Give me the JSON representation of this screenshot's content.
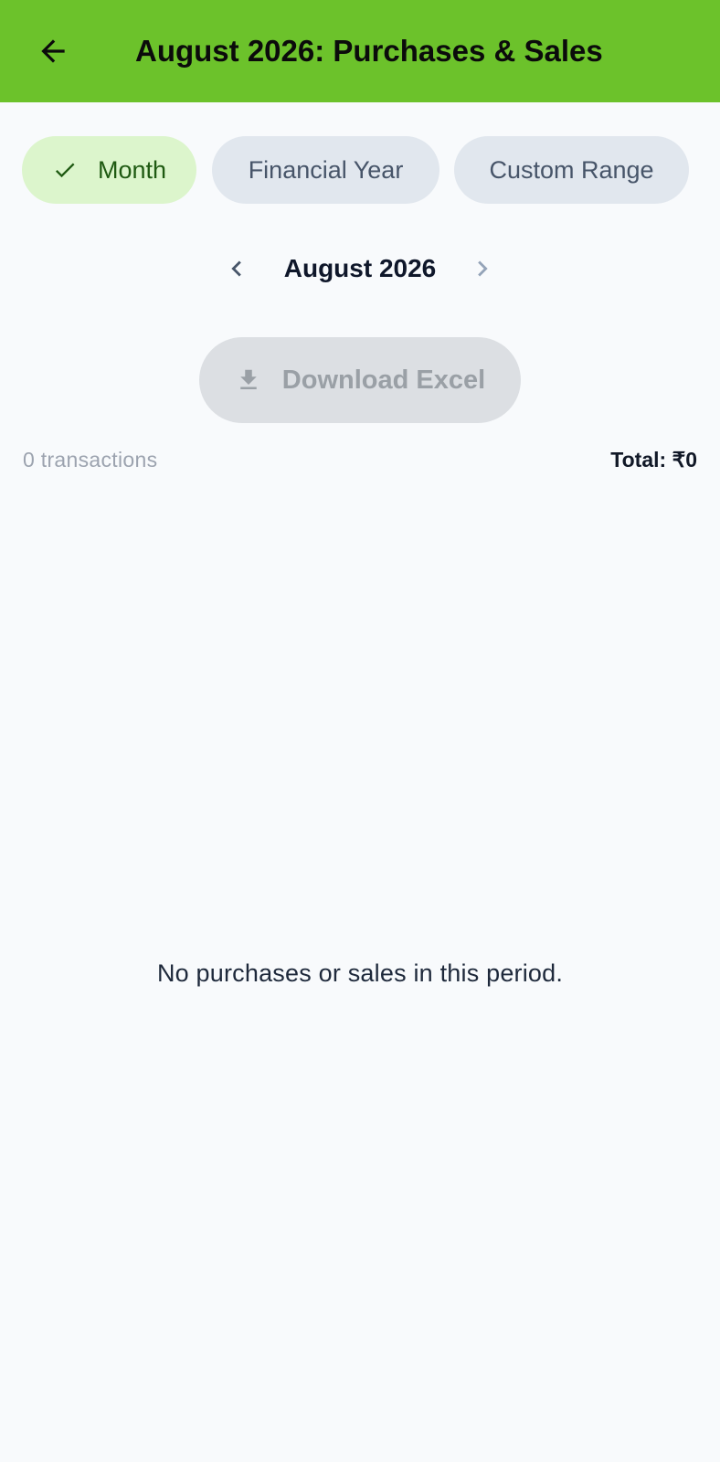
{
  "appbar": {
    "title": "August 2026: Purchases & Sales",
    "back_icon": "arrow-left-icon",
    "color": "#6cc22b"
  },
  "filters": {
    "month_label": "Month",
    "financial_year_label": "Financial Year",
    "custom_range_label": "Custom Range",
    "selected": "Month"
  },
  "period": {
    "label": "August 2026"
  },
  "actions": {
    "download_label": "Download Excel"
  },
  "summary": {
    "count_text": "0 transactions",
    "total_text": "Total: ₹0"
  },
  "empty_state": {
    "message": "No purchases or sales in this period."
  }
}
